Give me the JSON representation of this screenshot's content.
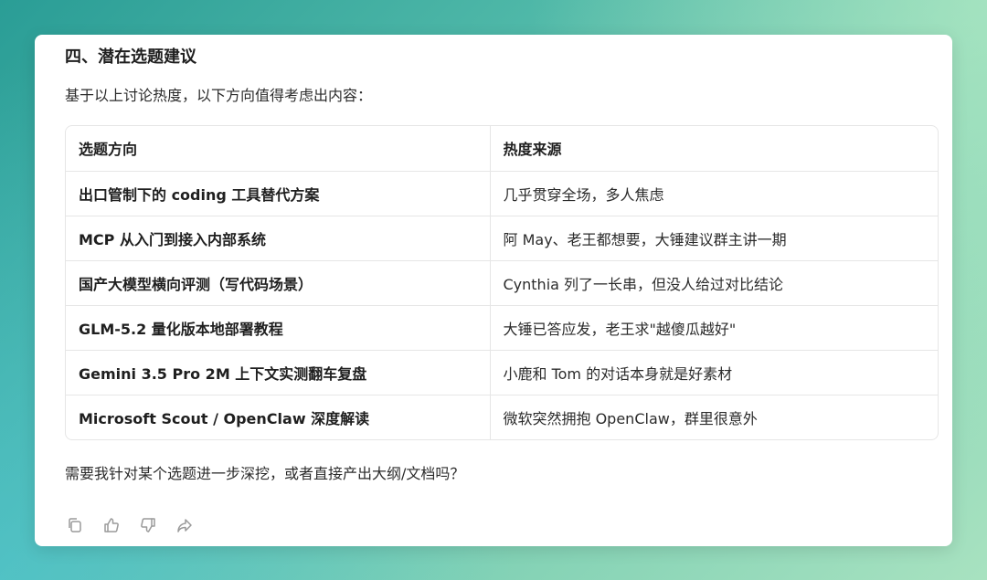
{
  "message": {
    "heading": "四、潜在选题建议",
    "intro": "基于以上讨论热度，以下方向值得考虑出内容：",
    "table": {
      "headers": [
        "选题方向",
        "热度来源"
      ],
      "rows": [
        {
          "topic": "出口管制下的 coding 工具替代方案",
          "source": "几乎贯穿全场，多人焦虑"
        },
        {
          "topic": "MCP 从入门到接入内部系统",
          "source": "阿 May、老王都想要，大锤建议群主讲一期"
        },
        {
          "topic": "国产大模型横向评测（写代码场景）",
          "source": "Cynthia 列了一长串，但没人给过对比结论"
        },
        {
          "topic": "GLM-5.2 量化版本地部署教程",
          "source": "大锤已答应发，老王求\"越傻瓜越好\""
        },
        {
          "topic": "Gemini 3.5 Pro 2M 上下文实测翻车复盘",
          "source": "小鹿和 Tom 的对话本身就是好素材"
        },
        {
          "topic": "Microsoft Scout / OpenClaw 深度解读",
          "source": "微软突然拥抱 OpenClaw，群里很意外"
        }
      ]
    },
    "closing": "需要我针对某个选题进一步深挖，或者直接产出大纲/文档吗？"
  },
  "actions": {
    "icons": [
      "copy-icon",
      "thumbs-up-icon",
      "thumbs-down-icon",
      "share-icon"
    ]
  },
  "colors": {
    "text": "#1f1f1f",
    "border": "#e6e6e6",
    "icon": "#9a9a9a"
  }
}
